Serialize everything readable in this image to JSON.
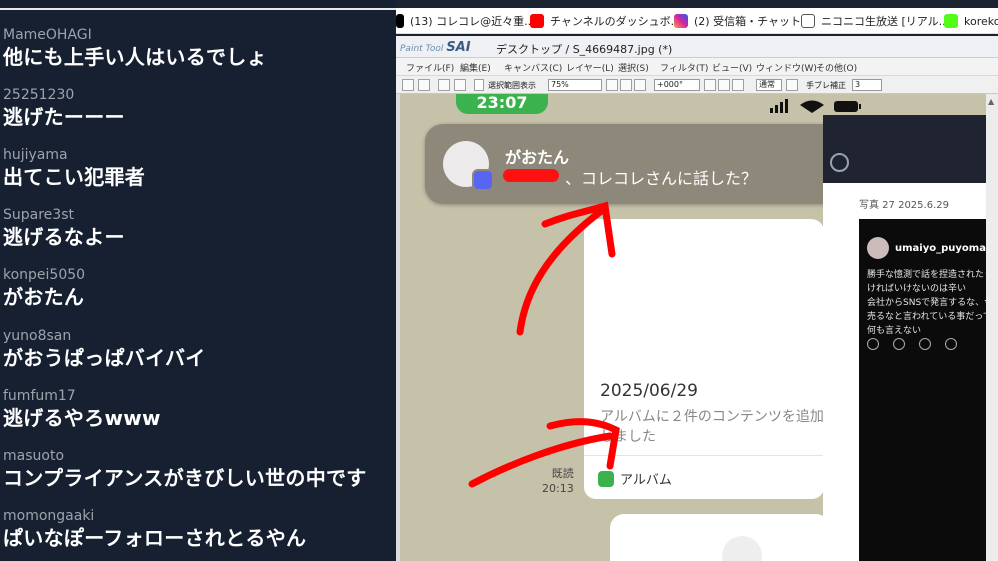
{
  "chat": {
    "messages": [
      {
        "user": "MameOHAGI",
        "text": "他にも上手い人はいるでしょ"
      },
      {
        "user": "25251230",
        "text": "逃げたーーー"
      },
      {
        "user": "hujiyama",
        "text": "出てこい犯罪者"
      },
      {
        "user": "Supare3st",
        "text": "逃げるなよー"
      },
      {
        "user": "konpei5050",
        "text": "がおたん"
      },
      {
        "user": "yuno8san",
        "text": "がおうぱっぱバイバイ"
      },
      {
        "user": "fumfum17",
        "text": "逃げるやろwww"
      },
      {
        "user": "masuoto",
        "text": "コンプライアンスがきびしい世の中です"
      },
      {
        "user": "momongaaki",
        "text": "ぱいなぽーフォローされとるやん"
      }
    ]
  },
  "bookmarks": [
    {
      "label": "(13) コレコレ@近々重...",
      "icon": "x-icon",
      "color": "#000000"
    },
    {
      "label": "チャンネルのダッシュボ...",
      "icon": "youtube-icon",
      "color": "#ff0000"
    },
    {
      "label": "(2) 受信箱・チャット",
      "icon": "instagram-icon",
      "color": "#d6249f"
    },
    {
      "label": "ニコニコ生放送 [リアル...",
      "icon": "niconico-icon",
      "color": "#444444"
    },
    {
      "label": "korekor",
      "icon": "kick-icon",
      "color": "#53fc18"
    }
  ],
  "sai": {
    "logo_small": "Paint Tool",
    "logo_big": "SAI",
    "window_title": "デスクトップ / S_4669487.jpg (*)",
    "menu": [
      "ファイル(F)",
      "編集(E)",
      "キャンバス(C)",
      "レイヤー(L)",
      "選択(S)",
      "フィルタ(T)",
      "ビュー(V)",
      "ウィンドウ(W)",
      "その他(O)"
    ],
    "toolbar": {
      "selection_display": "選択範囲表示",
      "zoom": "75%",
      "rotation": "+000°",
      "blend": "通常",
      "stabilizer_label": "手ブレ補正",
      "stabilizer_value": "3"
    }
  },
  "phone": {
    "time": "23:07",
    "notification": {
      "sender": "がおたん",
      "message": "、コレコレさんに話した？"
    },
    "post": {
      "date": "2025/06/29",
      "description": "アルバムに２件のコンテンツを追加しました",
      "album_label": "アルバム",
      "read_label": "既読",
      "time": "20:13"
    }
  },
  "right_pane": {
    "photo_title": "写真 27  2025.6.29",
    "tweet_user": "umaiyo_puyoman",
    "tweet_lines": [
      "勝手な憶測で話を捏造されたり、",
      "ければいけないのは辛い",
      "会社からSNSで発言するな、今後",
      "売るなと言われている事だってあ",
      "何も言えない"
    ]
  }
}
